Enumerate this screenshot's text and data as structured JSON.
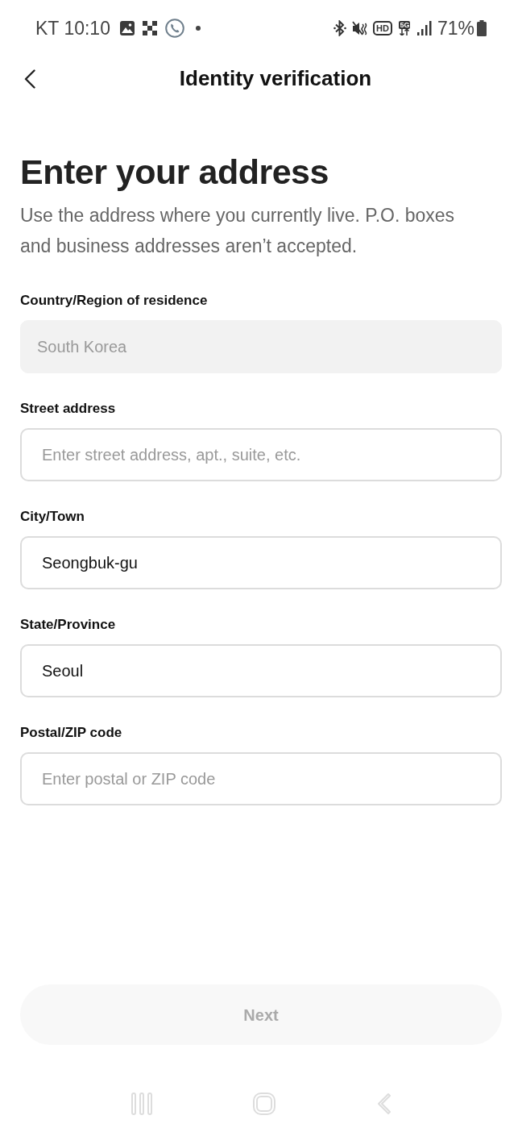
{
  "status_bar": {
    "carrier": "KT",
    "time": "10:10",
    "hd_badge": "HD",
    "network_type": "5G",
    "battery": "71%"
  },
  "header": {
    "title": "Identity verification"
  },
  "heading": "Enter your address",
  "description": "Use the address where you currently live. P.O. boxes and business addresses aren’t accepted.",
  "fields": [
    {
      "label": "Country/Region of residence",
      "value": "South Korea",
      "disabled": true
    },
    {
      "label": "Street address",
      "placeholder": "Enter street address, apt., suite, etc.",
      "disabled": false
    },
    {
      "label": "City/Town",
      "value": "Seongbuk-gu",
      "disabled": false
    },
    {
      "label": "State/Province",
      "value": "Seoul",
      "disabled": false
    },
    {
      "label": "Postal/ZIP code",
      "placeholder": "Enter postal or ZIP code",
      "disabled": false
    }
  ],
  "next_button": {
    "label": "Next",
    "disabled": true
  }
}
